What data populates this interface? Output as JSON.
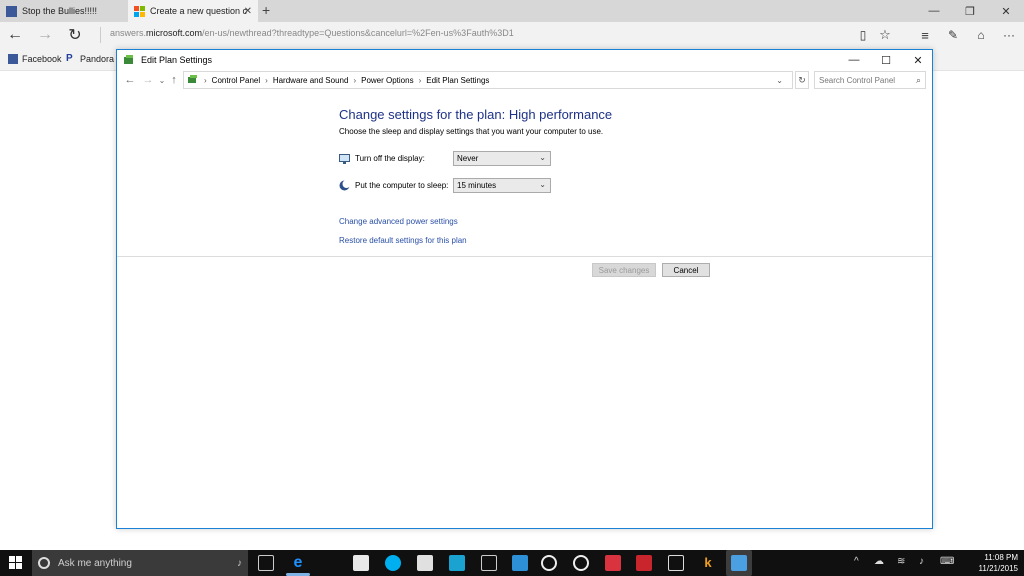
{
  "browser": {
    "tabs": [
      {
        "label": "Stop the Bullies!!!!!",
        "active": false
      },
      {
        "label": "Create a new question c",
        "active": true
      }
    ],
    "address": {
      "prefix": "answers.",
      "domain": "microsoft.com",
      "path": "/en-us/newthread?threadtype=Questions&cancelurl=%2Fen-us%3Fauth%3D1"
    },
    "favorites": [
      {
        "label": "Facebook",
        "icon": "facebook-icon"
      },
      {
        "label": "Pandora",
        "icon": "pandora-icon"
      }
    ]
  },
  "dialog": {
    "title": "Edit Plan Settings",
    "breadcrumbs": [
      "Control Panel",
      "Hardware and Sound",
      "Power Options",
      "Edit Plan Settings"
    ],
    "search_placeholder": "Search Control Panel",
    "heading": "Change settings for the plan: High performance",
    "subheading": "Choose the sleep and display settings that you want your computer to use.",
    "display_label": "Turn off the display:",
    "display_value": "Never",
    "sleep_label": "Put the computer to sleep:",
    "sleep_value": "15 minutes",
    "link_advanced": "Change advanced power settings",
    "link_restore": "Restore default settings for this plan",
    "save_label": "Save changes",
    "cancel_label": "Cancel"
  },
  "taskbar": {
    "search_placeholder": "Ask me anything",
    "time": "11:08 PM",
    "date": "11/21/2015"
  },
  "colors": {
    "heading": "#1e3287",
    "link": "#2a4fa6",
    "dialog_border": "#1a82d6",
    "taskbar": "#101010"
  }
}
